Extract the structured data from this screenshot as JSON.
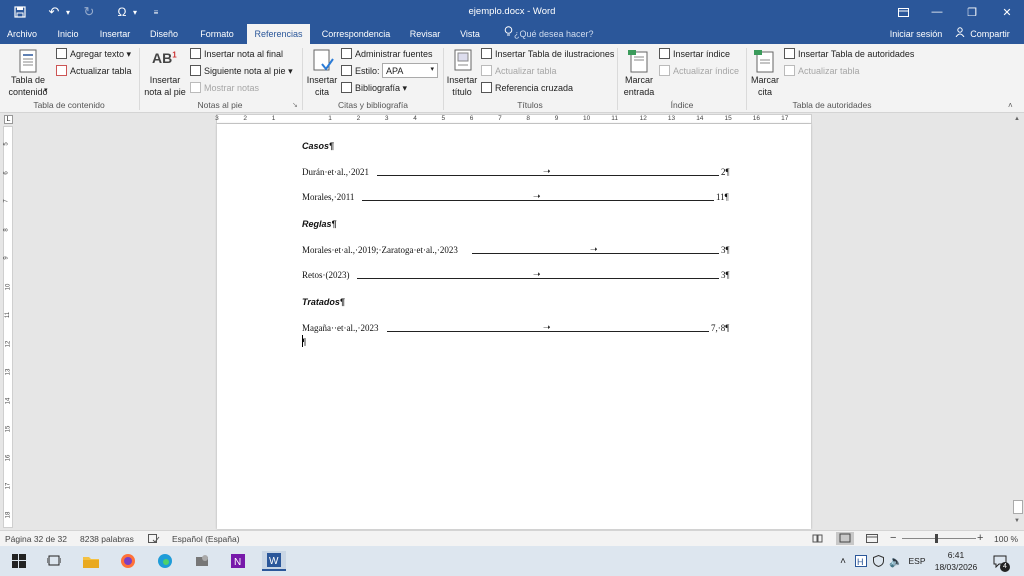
{
  "titlebar": {
    "title": "ejemplo.docx - Word",
    "quick_access": [
      "save-icon",
      "undo-icon",
      "redo-icon",
      "omega-icon",
      "customize-icon"
    ],
    "controls": [
      "ribbon-display-icon",
      "minimize-icon",
      "maximize-icon",
      "close-icon"
    ]
  },
  "tabs": {
    "items": [
      "Archivo",
      "Inicio",
      "Insertar",
      "Diseño",
      "Formato",
      "Referencias",
      "Correspondencia",
      "Revisar",
      "Vista"
    ],
    "active": "Referencias",
    "search_placeholder": "¿Qué desea hacer?",
    "signin": "Iniciar sesión",
    "share": "Compartir"
  },
  "ribbon": {
    "toc": {
      "big": "Tabla de contenido",
      "add_text": "Agregar texto",
      "update": "Actualizar tabla",
      "group": "Tabla de contenido"
    },
    "footnotes": {
      "big": "Insertar nota al pie",
      "insert_endnote": "Insertar nota al final",
      "next_footnote": "Siguiente nota al pie",
      "show_notes": "Mostrar notas",
      "group": "Notas al pie"
    },
    "citations": {
      "big": "Insertar cita",
      "manage_sources": "Administrar fuentes",
      "style_label": "Estilo:",
      "style_value": "APA",
      "bibliography": "Bibliografía",
      "group": "Citas y bibliografía"
    },
    "captions": {
      "big": "Insertar título",
      "insert_table_figures": "Insertar Tabla de ilustraciones",
      "update_table": "Actualizar tabla",
      "cross_ref": "Referencia cruzada",
      "group": "Títulos"
    },
    "index": {
      "big": "Marcar entrada",
      "insert_index": "Insertar índice",
      "update_index": "Actualizar índice",
      "group": "Índice"
    },
    "authorities": {
      "big": "Marcar cita",
      "insert_table": "Insertar Tabla de autoridades",
      "update_table": "Actualizar tabla",
      "group": "Tabla de autoridades"
    }
  },
  "ruler": {
    "labels": [
      "3",
      "2",
      "1",
      "1",
      "2",
      "3",
      "4",
      "5",
      "6",
      "7",
      "8",
      "9",
      "10",
      "11",
      "12",
      "13",
      "14",
      "15",
      "16",
      "17"
    ],
    "vlabels": [
      "5",
      "6",
      "7",
      "8",
      "9",
      "10",
      "11",
      "12",
      "13",
      "14",
      "15",
      "16",
      "17",
      "18"
    ]
  },
  "document": {
    "sections": [
      {
        "heading": "Casos¶",
        "entries": [
          {
            "text": "Durán·et·al.,·2021",
            "page": "2¶"
          },
          {
            "text": "Morales,·2011",
            "page": "11¶"
          }
        ]
      },
      {
        "heading": "Reglas¶",
        "entries": [
          {
            "text": "Morales·et·al.,·2019;·Zaratoga·et·al.,·2023",
            "page": "3¶"
          },
          {
            "text": "Retos·(2023)",
            "page": "3¶"
          }
        ]
      },
      {
        "heading": "Tratados¶",
        "entries": [
          {
            "text": "Magaña··et·al.,·2023",
            "page": "7,·8¶"
          }
        ]
      }
    ],
    "final_mark": "¶"
  },
  "status": {
    "page": "Página 32 de 32",
    "words": "8238 palabras",
    "language": "Español (España)",
    "zoom": "100 %",
    "zoom_minus": "−",
    "zoom_plus": "+"
  },
  "taskbar": {
    "language": "ESP",
    "time": "6:41",
    "date": "18/03/2026",
    "notification_count": "4"
  },
  "colors": {
    "word_blue": "#2b579a",
    "ribbon_bg": "#f3f3f3",
    "page_bg": "#ffffff"
  }
}
